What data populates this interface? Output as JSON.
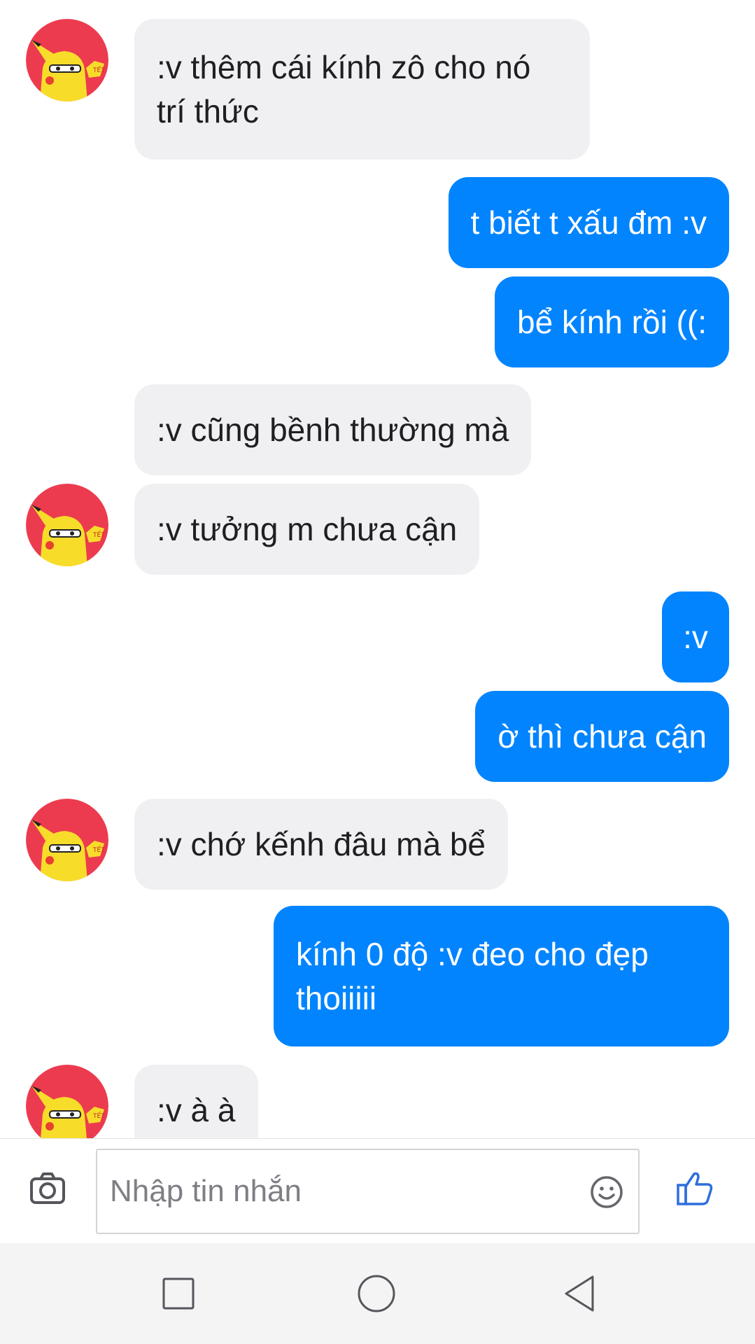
{
  "conversation": {
    "messages": [
      {
        "from": "them",
        "text": ":v thêm cái kính zô cho nó\ntrí thức"
      },
      {
        "from": "me",
        "text": "t biết t xấu đm :v"
      },
      {
        "from": "me",
        "text": "bể kính rồi ((:"
      },
      {
        "from": "them",
        "text": ":v cũng bềnh thường mà"
      },
      {
        "from": "them",
        "text": ":v tưởng m chưa cận"
      },
      {
        "from": "me",
        "text": ":v"
      },
      {
        "from": "me",
        "text": "ờ thì chưa cận"
      },
      {
        "from": "them",
        "text": ":v chớ kếnh đâu mà bể"
      },
      {
        "from": "me",
        "text": "kính 0 độ :v đeo cho đẹp\nthoiiiii"
      },
      {
        "from": "them",
        "text": ":v à à"
      }
    ],
    "avatar": {
      "icon": "pikachu-avatar-icon",
      "badge_text": "TẾT"
    }
  },
  "composer": {
    "placeholder": "Nhập tin nhắn",
    "value": "",
    "camera_icon": "camera-icon",
    "emoji_icon": "smiley-icon",
    "like_icon": "thumbs-up-icon"
  },
  "navbar": {
    "items": [
      "recents-square-icon",
      "home-circle-icon",
      "back-triangle-icon"
    ]
  },
  "colors": {
    "outgoing_bubble": "#0284fe",
    "incoming_bubble": "#f0f0f3",
    "accent": "#2d6fdd"
  }
}
